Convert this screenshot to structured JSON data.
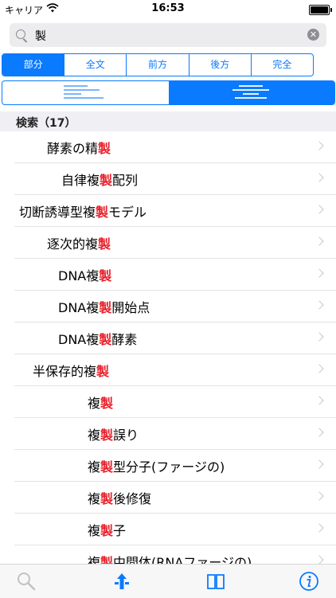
{
  "status": {
    "carrier": "キャリア",
    "time": "16:53"
  },
  "search": {
    "query": "製"
  },
  "segments": [
    {
      "label": "部分",
      "selected": true
    },
    {
      "label": "全文",
      "selected": false
    },
    {
      "label": "前方",
      "selected": false
    },
    {
      "label": "後方",
      "selected": false
    },
    {
      "label": "完全",
      "selected": false
    }
  ],
  "layout_options": [
    {
      "icon": "align-left-icon",
      "selected": false
    },
    {
      "icon": "align-center-icon",
      "selected": true
    }
  ],
  "results": {
    "header": "検索（17）",
    "rows": [
      {
        "pre": "酵素の精",
        "hl": "製",
        "post": ""
      },
      {
        "pre": "自律複",
        "hl": "製",
        "post": "配列"
      },
      {
        "pre": "切断誘導型複",
        "hl": "製",
        "post": "モデル"
      },
      {
        "pre": "逐次的複",
        "hl": "製",
        "post": ""
      },
      {
        "pre": "DNA複",
        "hl": "製",
        "post": ""
      },
      {
        "pre": "DNA複",
        "hl": "製",
        "post": "開始点"
      },
      {
        "pre": "DNA複",
        "hl": "製",
        "post": "酵素"
      },
      {
        "pre": "半保存的複",
        "hl": "製",
        "post": ""
      },
      {
        "pre": "複",
        "hl": "製",
        "post": ""
      },
      {
        "pre": "複",
        "hl": "製",
        "post": "誤り"
      },
      {
        "pre": "複",
        "hl": "製",
        "post": "型分子(ファージの)"
      },
      {
        "pre": "複",
        "hl": "製",
        "post": "後修復"
      },
      {
        "pre": "複",
        "hl": "製",
        "post": "子"
      },
      {
        "pre": "複",
        "hl": "製",
        "post": "中間体(RNAファージの)"
      }
    ]
  },
  "tabbar": [
    "search-icon",
    "tree-icon",
    "book-icon",
    "info-icon"
  ],
  "colors": {
    "accent": "#0a7aff",
    "highlight": "#e8202a"
  }
}
